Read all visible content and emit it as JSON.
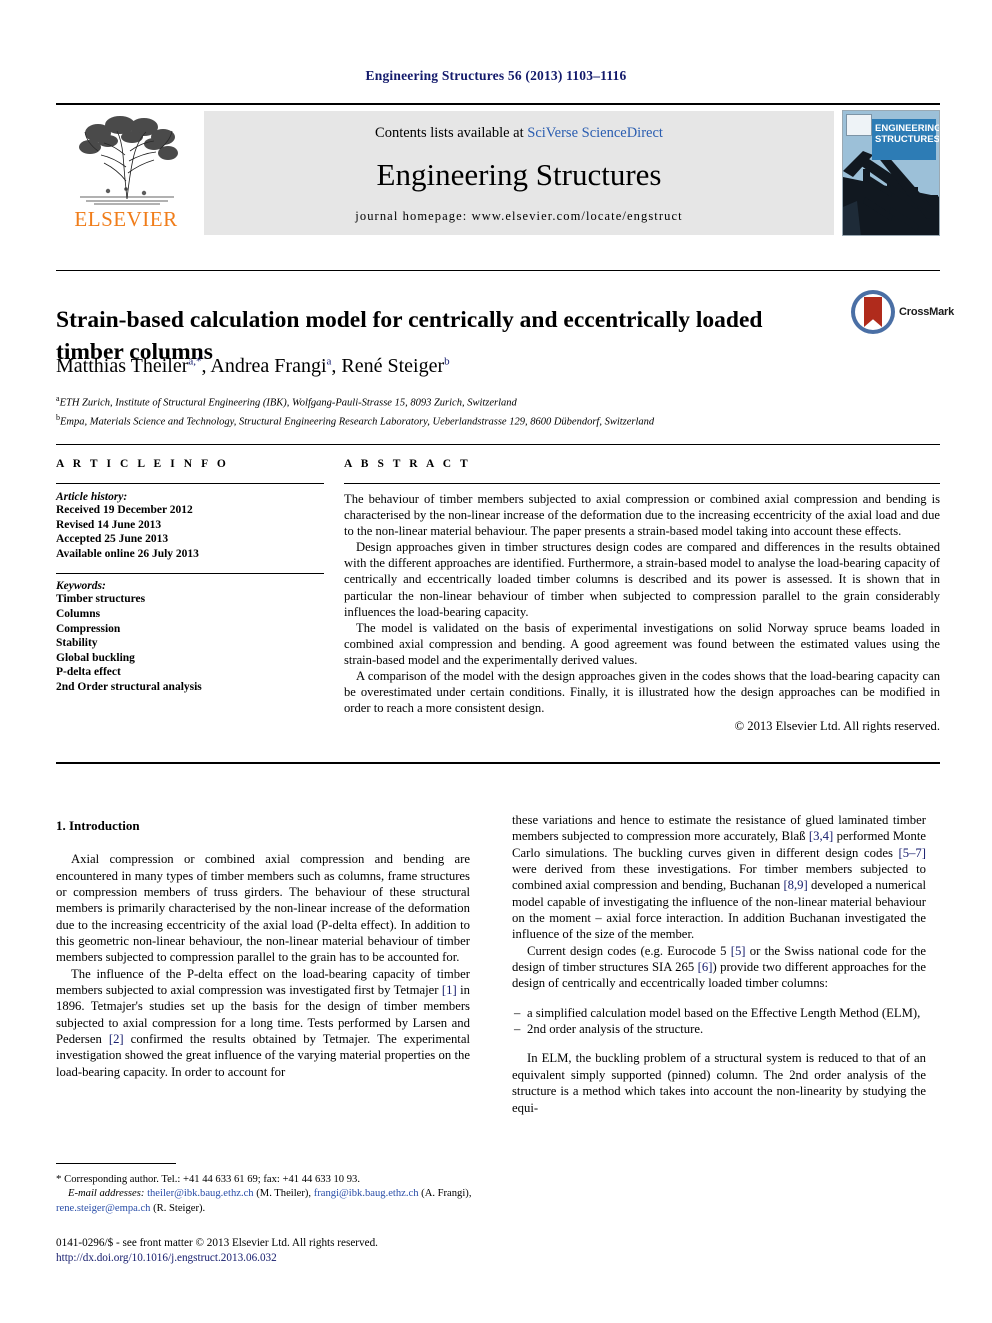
{
  "running_head": "Engineering Structures 56 (2013) 1103–1116",
  "masthead": {
    "publisher": "ELSEVIER",
    "contents_prefix": "Contents lists available at ",
    "contents_link": "SciVerse ScienceDirect",
    "journal_title": "Engineering Structures",
    "homepage": "journal homepage: www.elsevier.com/locate/engstruct",
    "cover_line1": "ENGINEERING",
    "cover_line2": "STRUCTURES"
  },
  "title": "Strain-based calculation model for centrically and eccentrically loaded timber columns",
  "crossmark_label": "CrossMark",
  "authors": [
    {
      "name": "Matthias Theiler",
      "marks": "a,*"
    },
    {
      "name": "Andrea Frangi",
      "marks": "a"
    },
    {
      "name": "René Steiger",
      "marks": "b"
    }
  ],
  "affiliations": [
    {
      "mark": "a",
      "text": "ETH Zurich, Institute of Structural Engineering (IBK), Wolfgang-Pauli-Strasse 15, 8093 Zurich, Switzerland"
    },
    {
      "mark": "b",
      "text": "Empa, Materials Science and Technology, Structural Engineering Research Laboratory, Ueberlandstrasse 129, 8600 Dübendorf, Switzerland"
    }
  ],
  "article_info": {
    "heading": "A R T I C L E   I N F O",
    "history_label": "Article history:",
    "history": [
      "Received 19 December 2012",
      "Revised 14 June 2013",
      "Accepted 25 June 2013",
      "Available online 26 July 2013"
    ],
    "keywords_label": "Keywords:",
    "keywords": [
      "Timber structures",
      "Columns",
      "Compression",
      "Stability",
      "Global buckling",
      "P-delta effect",
      "2nd Order structural analysis"
    ]
  },
  "abstract": {
    "heading": "A B S T R A C T",
    "paragraphs": [
      "The behaviour of timber members subjected to axial compression or combined axial compression and bending is characterised by the non-linear increase of the deformation due to the increasing eccentricity of the axial load and due to the non-linear material behaviour. The paper presents a strain-based model taking into account these effects.",
      "Design approaches given in timber structures design codes are compared and differences in the results obtained with the different approaches are identified. Furthermore, a strain-based model to analyse the load-bearing capacity of centrically and eccentrically loaded timber columns is described and its power is assessed. It is shown that in particular the non-linear behaviour of timber when subjected to compression parallel to the grain considerably influences the load-bearing capacity.",
      "The model is validated on the basis of experimental investigations on solid Norway spruce beams loaded in combined axial compression and bending. A good agreement was found between the estimated values using the strain-based model and the experimentally derived values.",
      "A comparison of the model with the design approaches given in the codes shows that the load-bearing capacity can be overestimated under certain conditions. Finally, it is illustrated how the design approaches can be modified in order to reach a more consistent design."
    ],
    "copyright": "© 2013 Elsevier Ltd. All rights reserved."
  },
  "body": {
    "section_heading": "1. Introduction",
    "left_paragraphs": [
      "Axial compression or combined axial compression and bending are encountered in many types of timber members such as columns, frame structures or compression members of truss girders. The behaviour of these structural members is primarily characterised by the non-linear increase of the deformation due to the increasing eccentricity of the axial load (P-delta effect). In addition to this geometric non-linear behaviour, the non-linear material behaviour of timber members subjected to compression parallel to the grain has to be accounted for."
    ],
    "left_p2_a": "The influence of the P-delta effect on the load-bearing capacity of timber members subjected to axial compression was investigated first by Tetmajer ",
    "left_p2_cite1": "[1]",
    "left_p2_b": " in 1896. Tetmajer's studies set up the basis for the design of timber members subjected to axial compression for a long time. Tests performed by Larsen and Pedersen ",
    "left_p2_cite2": "[2]",
    "left_p2_c": " confirmed the results obtained by Tetmajer. The experimental investigation showed the great influence of the varying material properties on the load-bearing capacity. In order to account for",
    "right_p1_a": "these variations and hence to estimate the resistance of glued laminated timber members subjected to compression more accurately, Blaß ",
    "right_p1_cite1": "[3,4]",
    "right_p1_b": " performed Monte Carlo simulations. The buckling curves given in different design codes ",
    "right_p1_cite2": "[5–7]",
    "right_p1_c": " were derived from these investigations. For timber members subjected to combined axial compression and bending, Buchanan ",
    "right_p1_cite3": "[8,9]",
    "right_p1_d": " developed a numerical model capable of investigating the influence of the non-linear material behaviour on the moment – axial force interaction. In addition Buchanan investigated the influence of the size of the member.",
    "right_p2_a": "Current design codes (e.g. Eurocode 5 ",
    "right_p2_cite1": "[5]",
    "right_p2_b": " or the Swiss national code for the design of timber structures SIA 265 ",
    "right_p2_cite2": "[6]",
    "right_p2_c": ") provide two different approaches for the design of centrically and eccentrically loaded timber columns:",
    "bullets": [
      "a simplified calculation model based on the Effective Length Method (ELM),",
      "2nd order analysis of the structure."
    ],
    "right_p3": "In ELM, the buckling problem of a structural system is reduced to that of an equivalent simply supported (pinned) column. The 2nd order analysis of the structure is a method which takes into account the non-linearity by studying the equi-"
  },
  "footnotes": {
    "corresponding": "Corresponding author. Tel.: +41 44 633 61 69; fax: +41 44 633 10 93.",
    "email_label": "E-mail addresses:",
    "email1": "theiler@ibk.baug.ethz.ch",
    "email1_owner": " (M. Theiler), ",
    "email2": "frangi@ibk.baug.ethz.ch",
    "email2_owner": " (A. Frangi), ",
    "email3": "rene.steiger@empa.ch",
    "email3_owner": " (R. Steiger).",
    "issn_line": "0141-0296/$ - see front matter © 2013 Elsevier Ltd. All rights reserved.",
    "doi_line": "http://dx.doi.org/10.1016/j.engstruct.2013.06.032"
  }
}
